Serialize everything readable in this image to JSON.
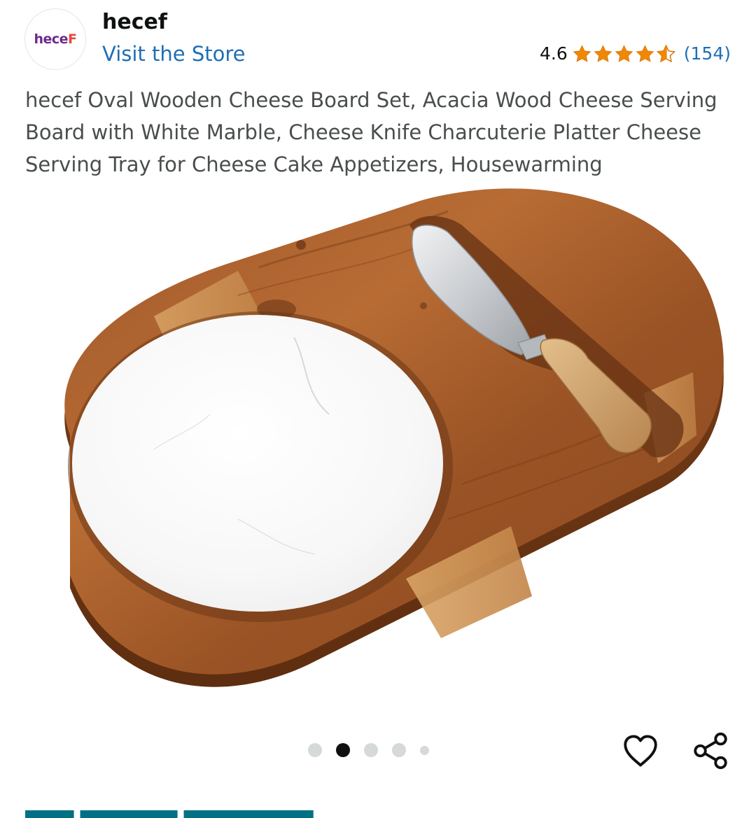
{
  "store": {
    "logo_text": "hece",
    "logo_mark": "F",
    "name": "hecef",
    "link_label": "Visit the Store"
  },
  "rating": {
    "value": "4.6",
    "stars_filled": 4.6,
    "stars_total": 5,
    "count": "(154)",
    "star_color": "#f08804"
  },
  "product": {
    "title": "hecef Oval Wooden Cheese Board Set, Acacia Wood Cheese Serving Board with White Marble, Cheese Knife Charcuterie Platter Cheese Serving Tray for Cheese Cake Appetizers, Housewarming"
  },
  "carousel": {
    "dot_count": 5,
    "active_index": 1
  },
  "actions": {
    "wishlist_icon": "heart-outline-icon",
    "share_icon": "share-icon"
  }
}
